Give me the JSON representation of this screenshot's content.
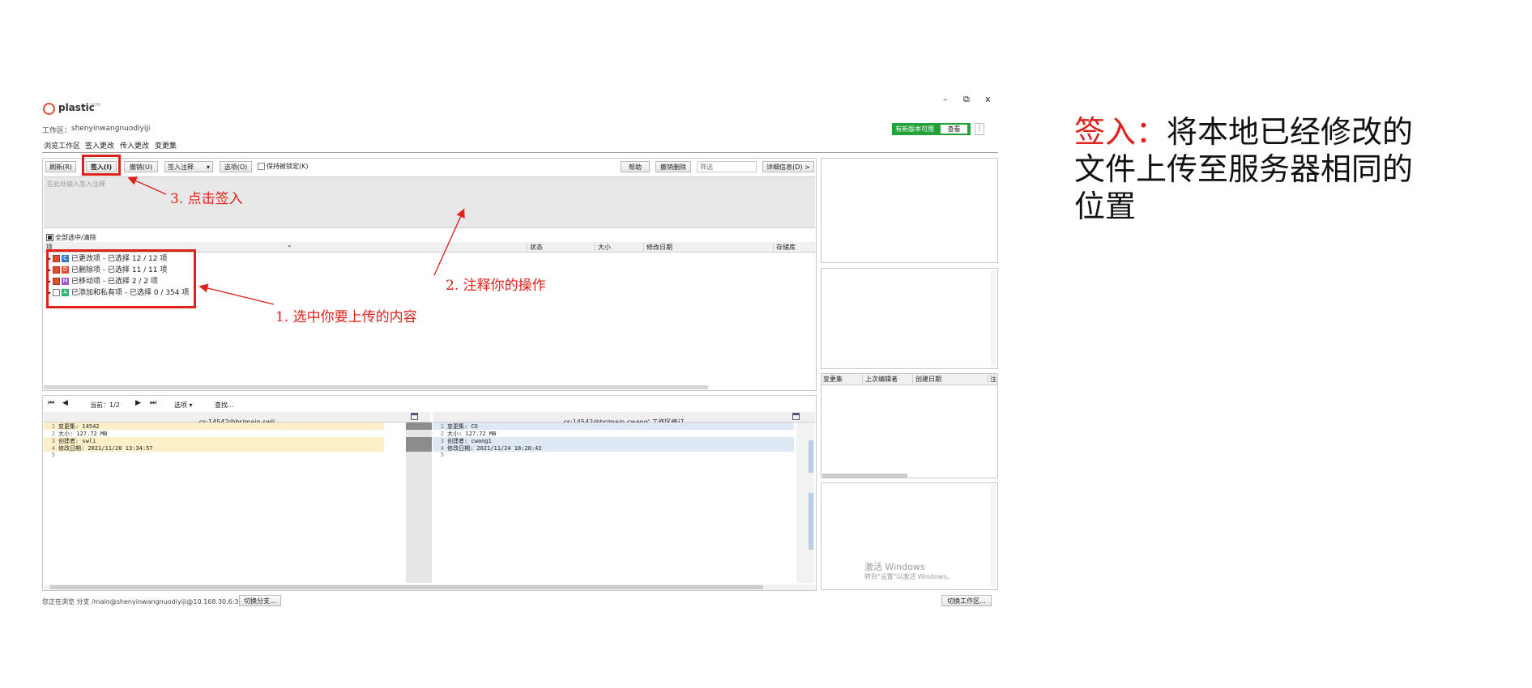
{
  "window": {
    "logo_text": "plastic",
    "logo_sub": "scm",
    "workspace_label": "工作区：",
    "workspace_value": "shenyinwangnuodiyiji",
    "minimize_glyph": "–",
    "restore_glyph": "⧉",
    "close_glyph": "x"
  },
  "nav": {
    "items": [
      "浏览工作区",
      "签入更改",
      "传入更改",
      "变更集"
    ]
  },
  "update_notice": {
    "text": "有新版本可用",
    "button": "查看",
    "menu_glyph": "⋮"
  },
  "toolbar": {
    "refresh": "刷新(R)",
    "checkin": "签入(I)",
    "undo": "撤销(U)",
    "checkin_comment": "签入注释",
    "options": "选项(O)",
    "keep_locked": "保持被锁定(K)",
    "help": "帮助",
    "undo_delete": "撤销删除",
    "filter_placeholder": "筛选",
    "details": "详细信息(D) >"
  },
  "comment": {
    "placeholder": "在此处输入签入注释"
  },
  "list": {
    "select_all": "全部选中/清除",
    "columns": [
      "项",
      "状态",
      "大小",
      "修改日期",
      "存储库"
    ],
    "rows": [
      {
        "badge": "C",
        "color": "#2f7ad0",
        "text": "已更改项 - 已选择 12 / 12 项"
      },
      {
        "badge": "D",
        "color": "#e24b2f",
        "text": "已删除项 - 已选择 11 / 11 项"
      },
      {
        "badge": "M",
        "color": "#9a5bd0",
        "text": "已移动项 - 已选择 2 / 2 项"
      },
      {
        "badge": "A",
        "color": "#2fb36e",
        "text": "已添加和私有项 - 已选择 0 / 354 项"
      }
    ]
  },
  "diff": {
    "nav_current": "当前：1/2",
    "options": "选项",
    "search": "查找...",
    "left_title": "cs:14542@br/main swli",
    "right_title": "cs:14542@br/main cwang' 工作区修订",
    "left_lines": [
      {
        "n": "1",
        "t": "变更集: 14542"
      },
      {
        "n": "2",
        "t": "大小: 127.72 MB"
      },
      {
        "n": "3",
        "t": "创建者: swli"
      },
      {
        "n": "4",
        "t": "修改日期: 2021/11/20 13:34:57"
      },
      {
        "n": "5",
        "t": ""
      }
    ],
    "right_lines": [
      {
        "n": "1",
        "t": "变更集: CO"
      },
      {
        "n": "2",
        "t": "大小: 127.72 MB"
      },
      {
        "n": "3",
        "t": "创建者: cwang1"
      },
      {
        "n": "4",
        "t": "修改日期: 2021/11/24 18:28:43"
      },
      {
        "n": "5",
        "t": ""
      }
    ]
  },
  "right_panel": {
    "columns": [
      "变更集",
      "上次编辑者",
      "创建日期",
      "注"
    ],
    "watermark_line1": "激活 Windows",
    "watermark_line2": "转到\"设置\"以激活 Windows。"
  },
  "statusbar": {
    "text": "您正在浏览 分支 /main@shenyinwangnuodiyiji@10.168.30.6:3087",
    "switch_branch": "切换分支...",
    "switch_workspace": "切换工作区..."
  },
  "annotations": {
    "step1": "1. 选中你要上传的内容",
    "step2": "2. 注释你的操作",
    "step3": "3. 点击签入"
  },
  "explanation": {
    "title": "签入：",
    "body": "将本地已经修改的文件上传至服务器相同的位置"
  },
  "colors": {
    "annotation_red": "#e0201a",
    "update_green": "#23a23a",
    "accent_orange": "#e24b2f"
  }
}
